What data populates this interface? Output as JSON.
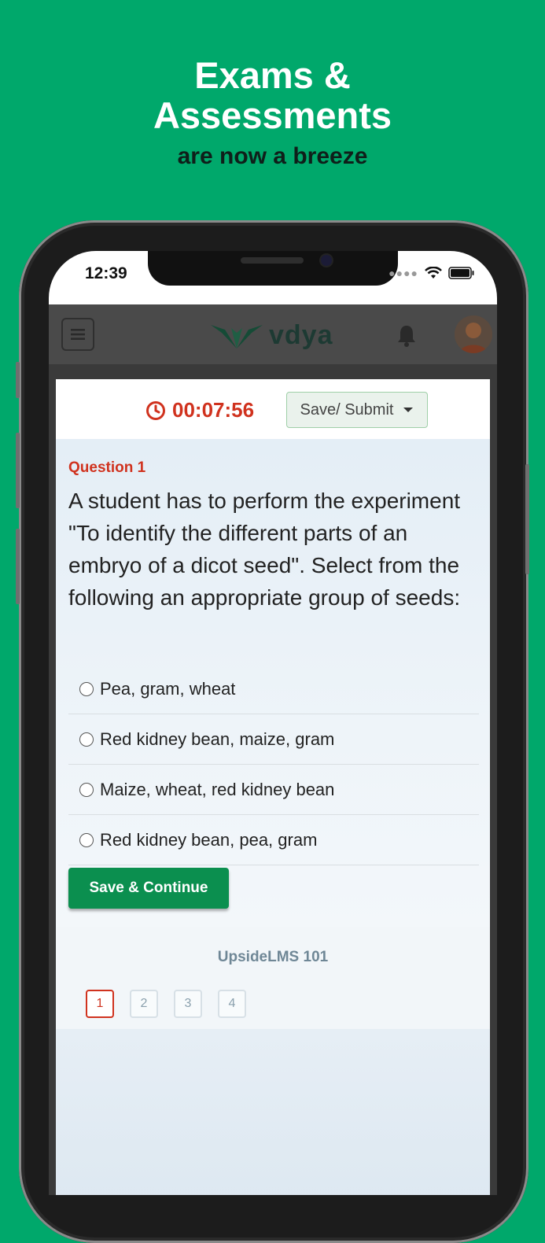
{
  "hero": {
    "title_line1": "Exams &",
    "title_line2": "Assessments",
    "subtitle": "are now a breeze"
  },
  "status_bar": {
    "time": "12:39"
  },
  "header": {
    "logo_text": "vdya"
  },
  "quiz": {
    "timer": "00:07:56",
    "save_submit_label": "Save/ Submit",
    "question_label": "Question 1",
    "question_text": "A student has to perform the experiment \"To identify the different parts of an embryo of a dicot seed\". Select from the following an appropriate group of seeds:",
    "options": [
      "Pea, gram, wheat",
      "Red kidney bean, maize, gram",
      "Maize, wheat, red kidney bean",
      "Red kidney bean, pea, gram"
    ],
    "continue_label": "Save & Continue"
  },
  "footer": {
    "course_name": "UpsideLMS 101",
    "pages": [
      "1",
      "2",
      "3",
      "4"
    ],
    "active_page": "1"
  },
  "colors": {
    "background": "#00a86b",
    "accent_red": "#d0321e",
    "button_green": "#0b8f4f"
  }
}
